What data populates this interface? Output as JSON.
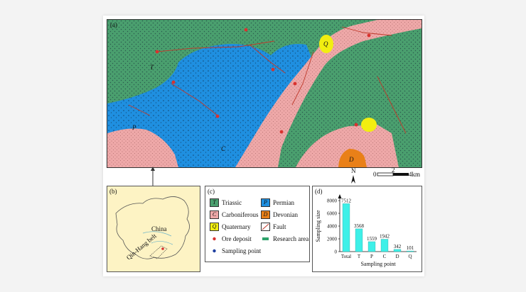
{
  "panel_labels": {
    "a": "(a)",
    "b": "(b)",
    "c": "(c)",
    "d": "(d)"
  },
  "map_a": {
    "unit_letters": [
      "T",
      "C",
      "P",
      "Q",
      "D"
    ],
    "north_label": "N",
    "scale": {
      "zero": "0",
      "mid": "2",
      "end": "4km"
    }
  },
  "map_b": {
    "country_label": "China",
    "belt_label": "Qin-Hang belt"
  },
  "legend": {
    "items": [
      {
        "symbol": "T",
        "label": "Triassic",
        "color": "#4a9f6e"
      },
      {
        "symbol": "P",
        "label": "Permian",
        "color": "#1f8fe0"
      },
      {
        "symbol": "C",
        "label": "Carboniferous",
        "color": "#eea8a8"
      },
      {
        "symbol": "D",
        "label": "Devonian",
        "color": "#e98018"
      },
      {
        "symbol": "Q",
        "label": "Quaternary",
        "color": "#f2ee10"
      },
      {
        "symbol": "",
        "label": "Fault",
        "color": "#c0392b"
      },
      {
        "symbol": "",
        "label": "Ore deposit",
        "color": "#d9322f"
      },
      {
        "symbol": "",
        "label": "Research area",
        "color": "#2ea36b"
      },
      {
        "symbol": "",
        "label": "Sampling point",
        "color": "#1f3fa0"
      }
    ]
  },
  "chart_data": {
    "type": "bar",
    "categories": [
      "Total",
      "T",
      "P",
      "C",
      "D",
      "Q"
    ],
    "values": [
      7512,
      3568,
      1559,
      1942,
      342,
      101
    ],
    "xlabel": "Sampling point",
    "ylabel": "Sampling size",
    "ylim": [
      0,
      8000
    ],
    "yticks": [
      0,
      2000,
      4000,
      6000,
      8000
    ],
    "bar_color": "#3ef0e8"
  }
}
